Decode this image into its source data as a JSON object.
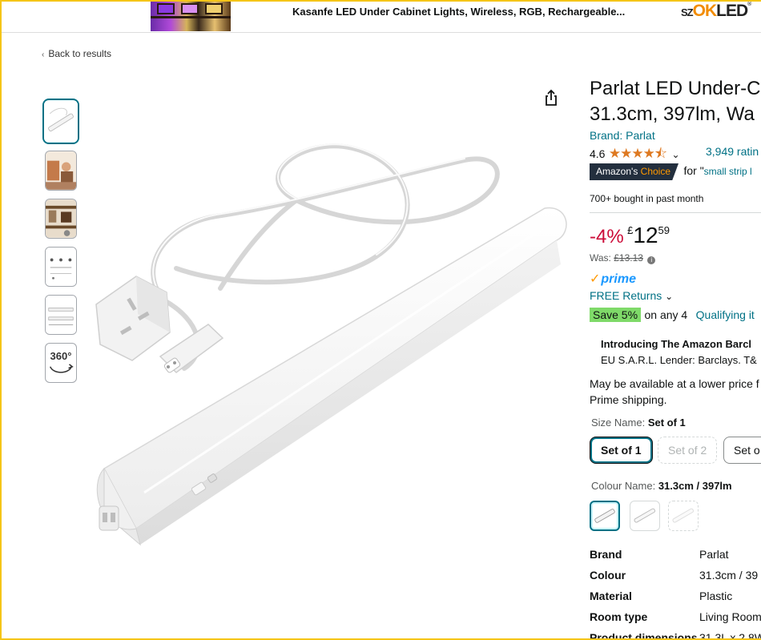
{
  "banner": {
    "title": "Kasanfe LED Under Cabinet Lights, Wireless, RGB, Rechargeable...",
    "logo_prefix": "SZ",
    "logo_ok": "OK",
    "logo_led": "LED",
    "logo_reg": "®"
  },
  "nav": {
    "back_label": "Back to results"
  },
  "thumbnails": {
    "badge_360": "360°"
  },
  "product": {
    "title_line1": "Parlat LED Under-C",
    "title_line2": "31.3cm, 397lm, Wa",
    "brand": "Brand: Parlat",
    "rating": "4.6",
    "stars": "★★★★⯪",
    "rating_count": "3,949 ratin",
    "badge_prefix": "Amazon's ",
    "badge_choice": "Choice",
    "badge_for": "for \"",
    "badge_query": "small strip l",
    "bought": "700+ bought in past month"
  },
  "price": {
    "discount": "-4%",
    "currency": "£",
    "whole": "12",
    "fraction": "59",
    "was_label": "Was: ",
    "was_price": "£13.13",
    "prime_check": "✓",
    "prime_label": "prime",
    "returns": "FREE Returns",
    "save_badge": "Save 5%",
    "save_text": "on any 4",
    "qualifying": "Qualifying it"
  },
  "promo": {
    "title": "Introducing The Amazon Barcl",
    "subtitle": "EU S.A.R.L. Lender: Barclays. T&"
  },
  "availability": {
    "line1": "May be available at a lower price f",
    "line2": "Prime shipping."
  },
  "size": {
    "label": "Size Name: ",
    "selected": "Set of 1",
    "options": [
      "Set of 1",
      "Set of 2",
      "Set o"
    ]
  },
  "colour": {
    "label": "Colour Name: ",
    "selected": "31.3cm / 397lm"
  },
  "specs": [
    {
      "key": "Brand",
      "value": "Parlat"
    },
    {
      "key": "Colour",
      "value": "31.3cm / 39"
    },
    {
      "key": "Material",
      "value": "Plastic"
    },
    {
      "key": "Room type",
      "value": "Living Room"
    },
    {
      "key": "Product dimensions",
      "value": "31.3L x 2.8W"
    }
  ],
  "colors": {
    "link": "#007185",
    "deal_red": "#cc0c39",
    "star_orange": "#de7921",
    "prime_blue": "#1a98ff",
    "badge_navy": "#232f3e",
    "save_green": "#7fda69",
    "frame_yellow": "#f5c518"
  },
  "icons": [
    "share-icon",
    "chevron-left-icon",
    "chevron-down-icon",
    "info-icon",
    "360-view-icon"
  ]
}
